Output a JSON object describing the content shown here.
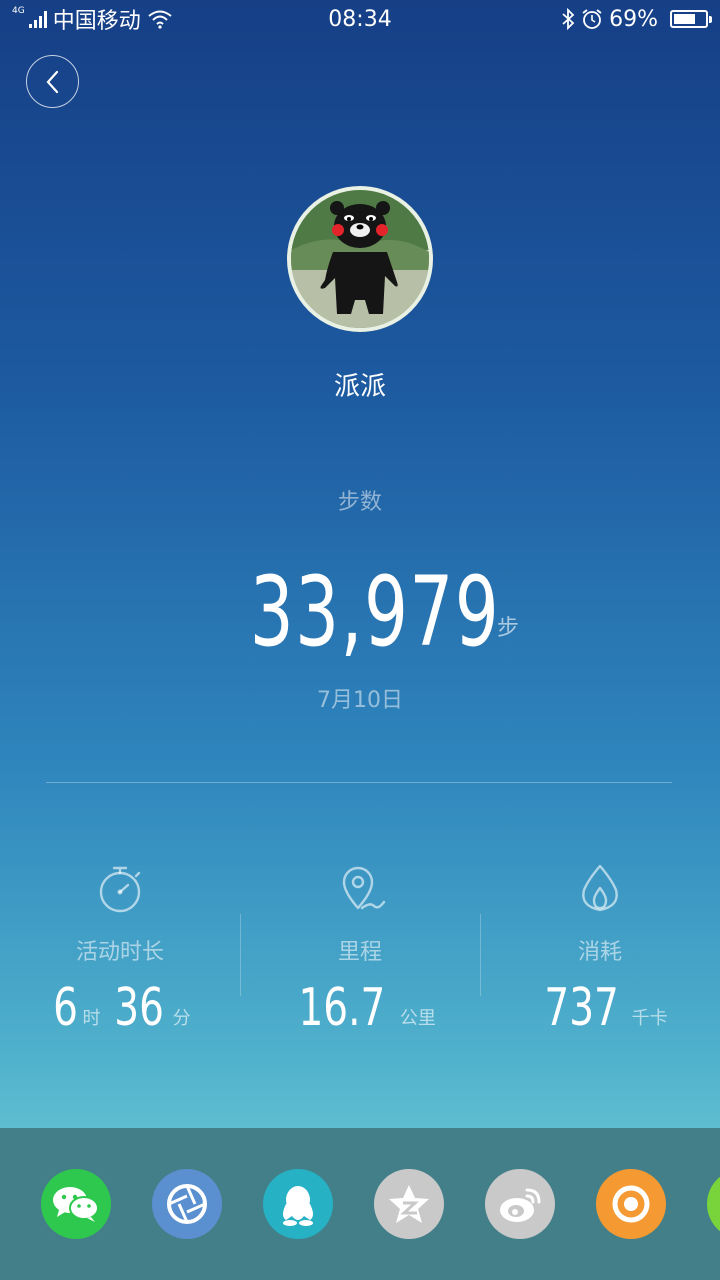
{
  "status_bar": {
    "network_type": "4G",
    "carrier": "中国移动",
    "time": "08:34",
    "battery_percent": "69%",
    "battery_level": 0.69,
    "icons": [
      "signal-icon",
      "wifi-icon",
      "bluetooth-icon",
      "alarm-icon",
      "battery-icon"
    ]
  },
  "header": {
    "back_icon": "chevron-left-icon"
  },
  "profile": {
    "name": "派派"
  },
  "steps": {
    "label": "步数",
    "value": "33,979",
    "unit": "步",
    "date": "7月10日"
  },
  "stats": {
    "duration": {
      "icon": "stopwatch-icon",
      "label": "活动时长",
      "hours": "6",
      "hours_unit": "时",
      "minutes": "36",
      "minutes_unit": "分"
    },
    "distance": {
      "icon": "location-pin-icon",
      "label": "里程",
      "value": "16.7",
      "unit": "公里"
    },
    "calories": {
      "icon": "flame-icon",
      "label": "消耗",
      "value": "737",
      "unit": "千卡"
    }
  },
  "share": {
    "targets": [
      {
        "name": "wechat",
        "color": "#2dc84d"
      },
      {
        "name": "wechat-moments",
        "color": "#5a8fd0"
      },
      {
        "name": "qq",
        "color": "#26b1c4"
      },
      {
        "name": "qzone",
        "color": "#c9c9c9"
      },
      {
        "name": "weibo",
        "color": "#c9c9c9"
      },
      {
        "name": "other-app",
        "color": "#f59a32"
      },
      {
        "name": "more",
        "color": "#79d33a"
      }
    ]
  },
  "colors": {
    "background_top": "#163f86",
    "background_bottom": "#5ebdd0",
    "share_bar": "#437f89"
  }
}
